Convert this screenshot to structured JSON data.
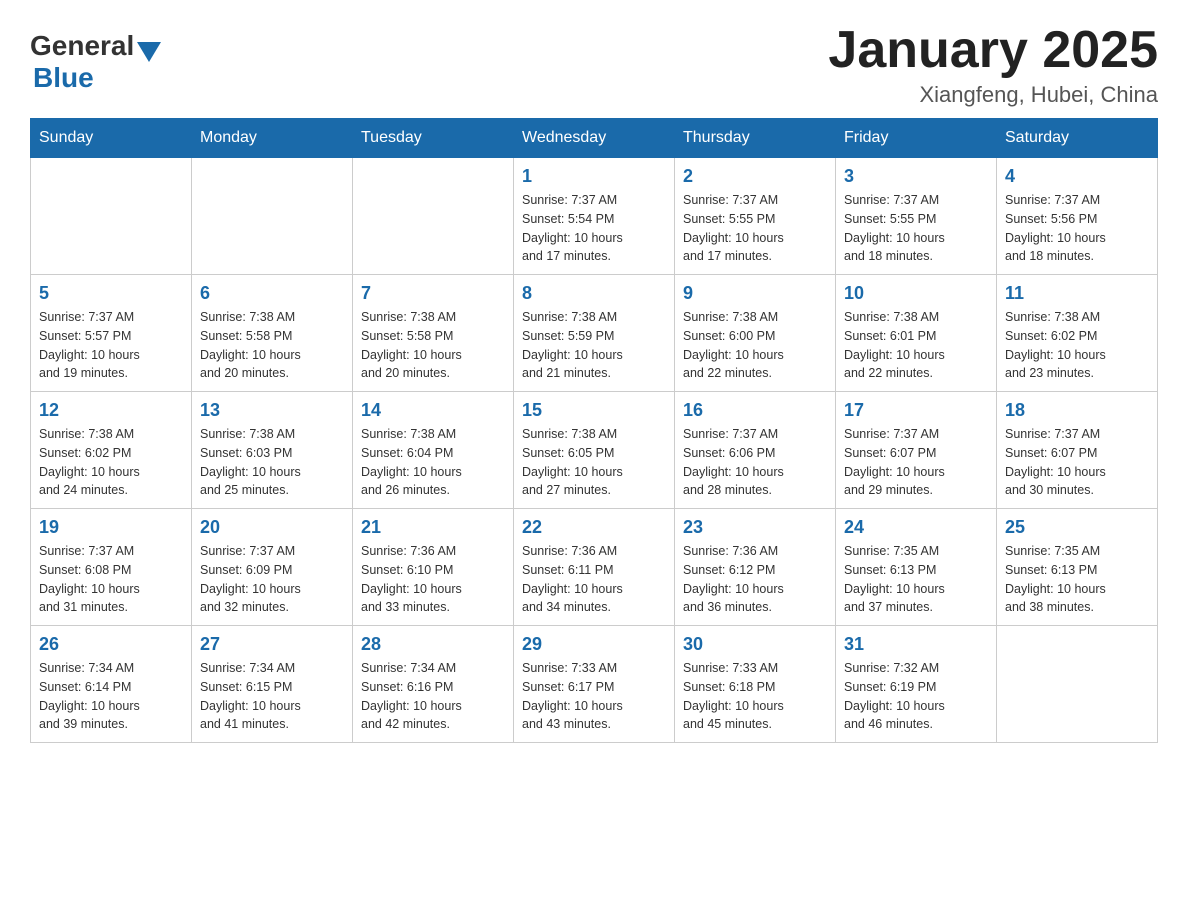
{
  "header": {
    "title": "January 2025",
    "subtitle": "Xiangfeng, Hubei, China",
    "logo": {
      "general": "General",
      "blue": "Blue"
    }
  },
  "days_of_week": [
    "Sunday",
    "Monday",
    "Tuesday",
    "Wednesday",
    "Thursday",
    "Friday",
    "Saturday"
  ],
  "weeks": [
    [
      {
        "day": "",
        "info": ""
      },
      {
        "day": "",
        "info": ""
      },
      {
        "day": "",
        "info": ""
      },
      {
        "day": "1",
        "info": "Sunrise: 7:37 AM\nSunset: 5:54 PM\nDaylight: 10 hours\nand 17 minutes."
      },
      {
        "day": "2",
        "info": "Sunrise: 7:37 AM\nSunset: 5:55 PM\nDaylight: 10 hours\nand 17 minutes."
      },
      {
        "day": "3",
        "info": "Sunrise: 7:37 AM\nSunset: 5:55 PM\nDaylight: 10 hours\nand 18 minutes."
      },
      {
        "day": "4",
        "info": "Sunrise: 7:37 AM\nSunset: 5:56 PM\nDaylight: 10 hours\nand 18 minutes."
      }
    ],
    [
      {
        "day": "5",
        "info": "Sunrise: 7:37 AM\nSunset: 5:57 PM\nDaylight: 10 hours\nand 19 minutes."
      },
      {
        "day": "6",
        "info": "Sunrise: 7:38 AM\nSunset: 5:58 PM\nDaylight: 10 hours\nand 20 minutes."
      },
      {
        "day": "7",
        "info": "Sunrise: 7:38 AM\nSunset: 5:58 PM\nDaylight: 10 hours\nand 20 minutes."
      },
      {
        "day": "8",
        "info": "Sunrise: 7:38 AM\nSunset: 5:59 PM\nDaylight: 10 hours\nand 21 minutes."
      },
      {
        "day": "9",
        "info": "Sunrise: 7:38 AM\nSunset: 6:00 PM\nDaylight: 10 hours\nand 22 minutes."
      },
      {
        "day": "10",
        "info": "Sunrise: 7:38 AM\nSunset: 6:01 PM\nDaylight: 10 hours\nand 22 minutes."
      },
      {
        "day": "11",
        "info": "Sunrise: 7:38 AM\nSunset: 6:02 PM\nDaylight: 10 hours\nand 23 minutes."
      }
    ],
    [
      {
        "day": "12",
        "info": "Sunrise: 7:38 AM\nSunset: 6:02 PM\nDaylight: 10 hours\nand 24 minutes."
      },
      {
        "day": "13",
        "info": "Sunrise: 7:38 AM\nSunset: 6:03 PM\nDaylight: 10 hours\nand 25 minutes."
      },
      {
        "day": "14",
        "info": "Sunrise: 7:38 AM\nSunset: 6:04 PM\nDaylight: 10 hours\nand 26 minutes."
      },
      {
        "day": "15",
        "info": "Sunrise: 7:38 AM\nSunset: 6:05 PM\nDaylight: 10 hours\nand 27 minutes."
      },
      {
        "day": "16",
        "info": "Sunrise: 7:37 AM\nSunset: 6:06 PM\nDaylight: 10 hours\nand 28 minutes."
      },
      {
        "day": "17",
        "info": "Sunrise: 7:37 AM\nSunset: 6:07 PM\nDaylight: 10 hours\nand 29 minutes."
      },
      {
        "day": "18",
        "info": "Sunrise: 7:37 AM\nSunset: 6:07 PM\nDaylight: 10 hours\nand 30 minutes."
      }
    ],
    [
      {
        "day": "19",
        "info": "Sunrise: 7:37 AM\nSunset: 6:08 PM\nDaylight: 10 hours\nand 31 minutes."
      },
      {
        "day": "20",
        "info": "Sunrise: 7:37 AM\nSunset: 6:09 PM\nDaylight: 10 hours\nand 32 minutes."
      },
      {
        "day": "21",
        "info": "Sunrise: 7:36 AM\nSunset: 6:10 PM\nDaylight: 10 hours\nand 33 minutes."
      },
      {
        "day": "22",
        "info": "Sunrise: 7:36 AM\nSunset: 6:11 PM\nDaylight: 10 hours\nand 34 minutes."
      },
      {
        "day": "23",
        "info": "Sunrise: 7:36 AM\nSunset: 6:12 PM\nDaylight: 10 hours\nand 36 minutes."
      },
      {
        "day": "24",
        "info": "Sunrise: 7:35 AM\nSunset: 6:13 PM\nDaylight: 10 hours\nand 37 minutes."
      },
      {
        "day": "25",
        "info": "Sunrise: 7:35 AM\nSunset: 6:13 PM\nDaylight: 10 hours\nand 38 minutes."
      }
    ],
    [
      {
        "day": "26",
        "info": "Sunrise: 7:34 AM\nSunset: 6:14 PM\nDaylight: 10 hours\nand 39 minutes."
      },
      {
        "day": "27",
        "info": "Sunrise: 7:34 AM\nSunset: 6:15 PM\nDaylight: 10 hours\nand 41 minutes."
      },
      {
        "day": "28",
        "info": "Sunrise: 7:34 AM\nSunset: 6:16 PM\nDaylight: 10 hours\nand 42 minutes."
      },
      {
        "day": "29",
        "info": "Sunrise: 7:33 AM\nSunset: 6:17 PM\nDaylight: 10 hours\nand 43 minutes."
      },
      {
        "day": "30",
        "info": "Sunrise: 7:33 AM\nSunset: 6:18 PM\nDaylight: 10 hours\nand 45 minutes."
      },
      {
        "day": "31",
        "info": "Sunrise: 7:32 AM\nSunset: 6:19 PM\nDaylight: 10 hours\nand 46 minutes."
      },
      {
        "day": "",
        "info": ""
      }
    ]
  ]
}
